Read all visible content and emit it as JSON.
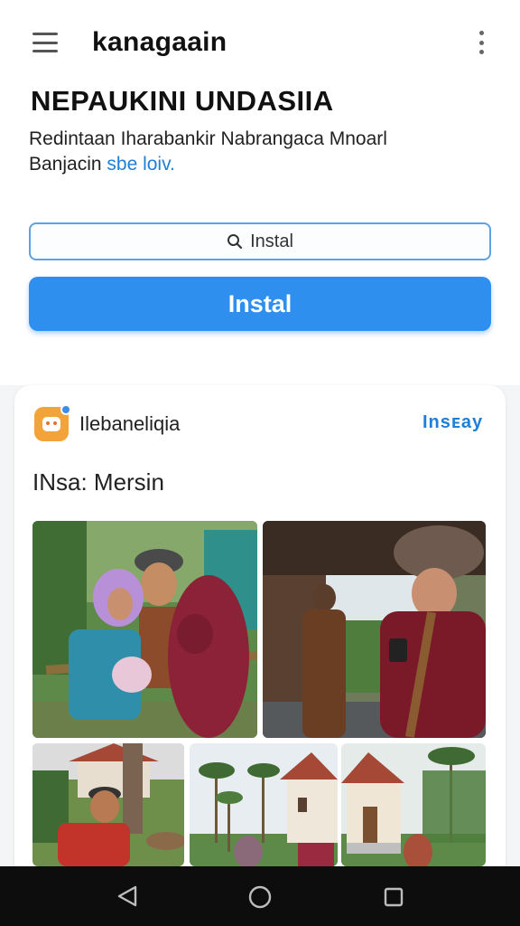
{
  "appbar": {
    "title": "kanagaain",
    "menu_icon": "hamburger-menu-icon",
    "more_icon": "more-vertical-icon"
  },
  "hero": {
    "headline": "NEPAUKINI UNDASIIA",
    "subtitle_line1": "Redintaan Iharabankir Nabrangaca Mnoarl",
    "subtitle_line2_prefix": "Banjacin ",
    "subtitle_line2_accent": "sbe loiv."
  },
  "search": {
    "label": "Instal",
    "icon": "search-icon"
  },
  "install_button": {
    "label": "Instal"
  },
  "card": {
    "app_icon": "app-logo-icon",
    "app_name": "Ilebaneliqia",
    "install_link": "Insᴇay",
    "section_title": "INsa: Mersin",
    "photos": [
      "family-with-baby-photo",
      "man-using-phone-photo",
      "man-in-red-shirt-photo",
      "palm-houses-photo",
      "tropical-house-photo"
    ]
  },
  "navbar": {
    "back_icon": "back-triangle-icon",
    "home_icon": "home-circle-icon",
    "recents_icon": "recents-square-icon"
  },
  "colors": {
    "accent": "#2f8fef",
    "link": "#1d7fd8",
    "app_icon_bg": "#f2a33a"
  }
}
